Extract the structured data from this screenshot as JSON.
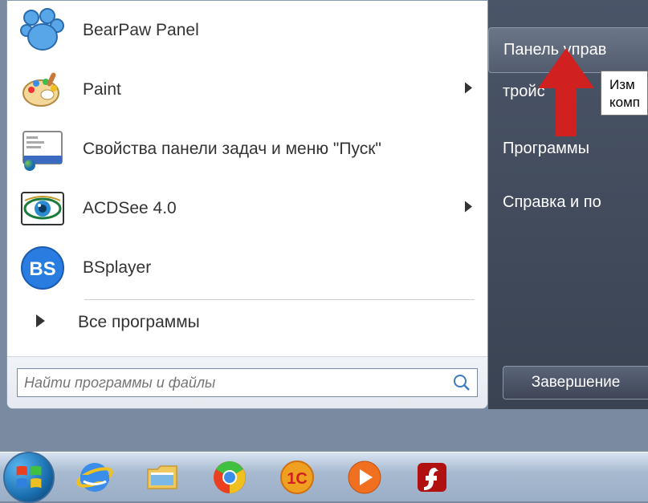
{
  "menu": {
    "items": [
      {
        "label": "BearPaw Panel",
        "icon": "bearpaw",
        "has_submenu": false
      },
      {
        "label": "Paint",
        "icon": "paint",
        "has_submenu": true
      },
      {
        "label": "Свойства панели задач и меню \"Пуск\"",
        "icon": "taskbar-props",
        "has_submenu": false
      },
      {
        "label": "ACDSee 4.0",
        "icon": "acdsee",
        "has_submenu": true
      },
      {
        "label": "BSplayer",
        "icon": "bsplayer",
        "has_submenu": false
      }
    ],
    "all_programs": "Все программы"
  },
  "search": {
    "placeholder": "Найти программы и файлы"
  },
  "right_panel": {
    "control_panel": "Панель управ",
    "devices": "тройс",
    "programs": "Программы",
    "help": "Справка и по",
    "shutdown": "Завершение"
  },
  "tooltip": {
    "line1": "Изм",
    "line2": "комп"
  },
  "taskbar": {
    "items": [
      "start",
      "ie",
      "explorer",
      "chrome",
      "1c",
      "wmp",
      "flash"
    ]
  }
}
